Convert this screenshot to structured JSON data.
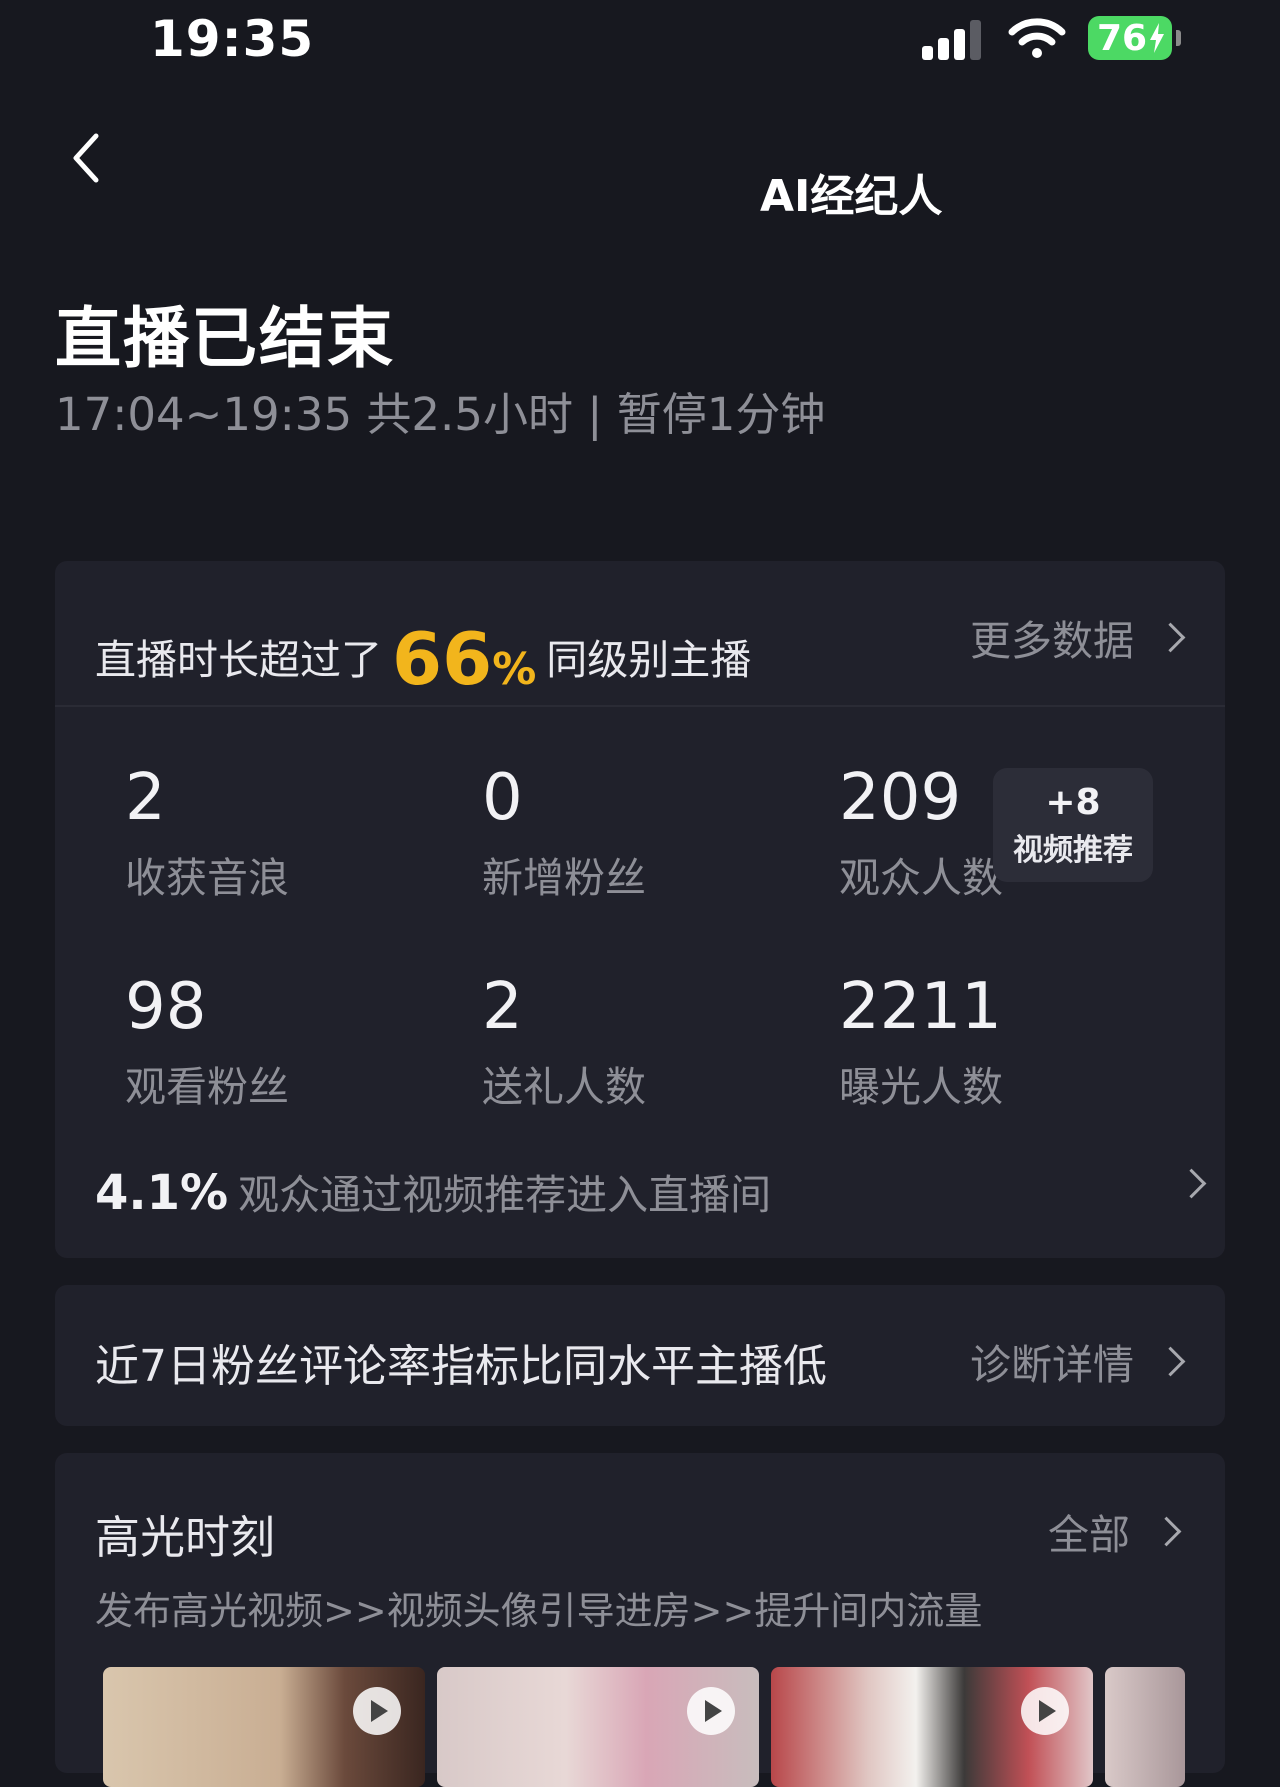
{
  "status_bar": {
    "time": "19:35",
    "battery": "76"
  },
  "nav": {
    "title": "AI经纪人"
  },
  "header": {
    "title": "直播已结束",
    "subtitle": "17:04~19:35 共2.5小时 | 暂停1分钟"
  },
  "ranking": {
    "prefix": "直播时长超过了",
    "percent": "66",
    "percent_sign": "%",
    "suffix": "同级别主播",
    "link": "更多数据"
  },
  "stats": [
    {
      "value": "2",
      "label": "收获音浪"
    },
    {
      "value": "0",
      "label": "新增粉丝"
    },
    {
      "value": "209",
      "label": "观众人数"
    },
    {
      "value": "98",
      "label": "观看粉丝"
    },
    {
      "value": "2",
      "label": "送礼人数"
    },
    {
      "value": "2211",
      "label": "曝光人数"
    }
  ],
  "recommend_chip": {
    "add": "+8",
    "label": "视频推荐"
  },
  "video_entry": {
    "percent": "4.1%",
    "text": "观众通过视频推荐进入直播间"
  },
  "diagnosis": {
    "text": "近7日粉丝评论率指标比同水平主播低",
    "link": "诊断详情"
  },
  "highlights": {
    "title": "高光时刻",
    "link": "全部",
    "subtitle": "发布高光视频>>视频头像引导进房>>提升间内流量"
  },
  "colors": {
    "accent": "#f2b51c",
    "background": "#17181f",
    "card": "#20212b",
    "battery": "#4cd964"
  }
}
